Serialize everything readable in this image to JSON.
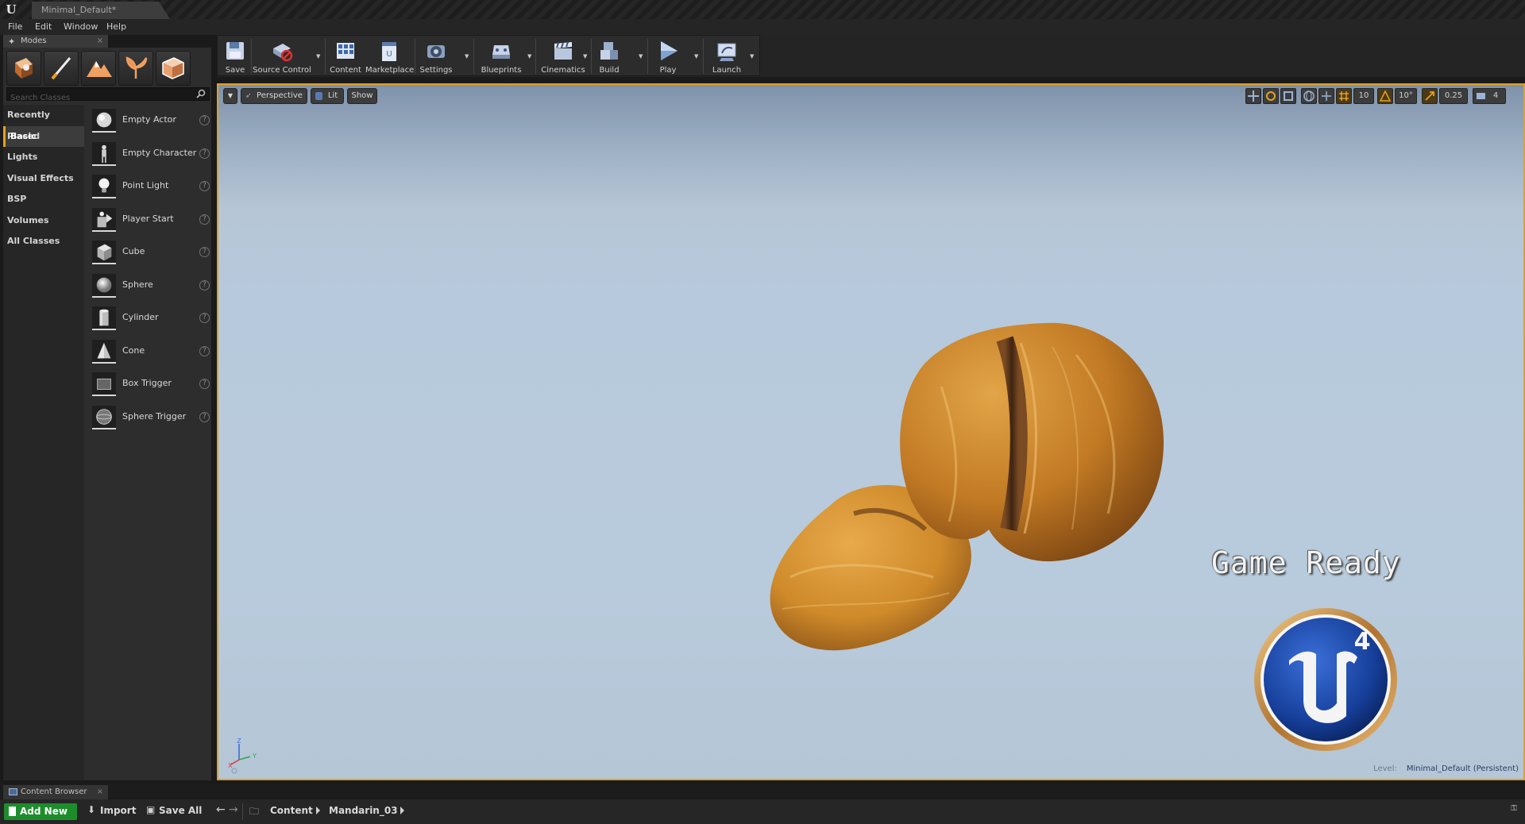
{
  "window": {
    "tab_title": "Minimal_Default*"
  },
  "menu": [
    "File",
    "Edit",
    "Window",
    "Help"
  ],
  "modes": {
    "tab_label": "Modes",
    "search_placeholder": "Search Classes",
    "categories": [
      "Recently Placed",
      "Basic",
      "Lights",
      "Visual Effects",
      "BSP",
      "Volumes",
      "All Classes"
    ],
    "active_category": "Basic",
    "items": [
      "Empty Actor",
      "Empty Character",
      "Point Light",
      "Player Start",
      "Cube",
      "Sphere",
      "Cylinder",
      "Cone",
      "Box Trigger",
      "Sphere Trigger"
    ],
    "help_glyph": "?"
  },
  "toolbar": {
    "save": "Save",
    "source_control": "Source Control",
    "content": "Content",
    "marketplace": "Marketplace",
    "settings": "Settings",
    "blueprints": "Blueprints",
    "cinematics": "Cinematics",
    "build": "Build",
    "play": "Play",
    "launch": "Launch"
  },
  "viewport": {
    "perspective": "Perspective",
    "lit": "Lit",
    "show": "Show",
    "grid_snap": "10",
    "rotation_snap": "10°",
    "scale_snap": "0.25",
    "camera_speed": "4",
    "overlay_text": "Game Ready",
    "logo_number": "4",
    "level_label": "Level:",
    "level_name": "Minimal_Default (Persistent)",
    "accent_color": "#e3a021"
  },
  "content_browser": {
    "tab_label": "Content Browser",
    "add_new": "Add New",
    "import": "Import",
    "save_all": "Save All",
    "path": [
      "Content",
      "Mandarin_03"
    ]
  }
}
